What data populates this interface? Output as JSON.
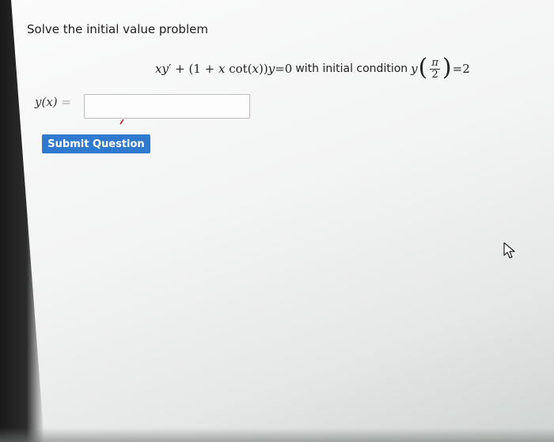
{
  "problem": {
    "instruction": "Solve the initial value problem",
    "equation_lhs_parts": [
      "xy",
      "′ + (1 + ",
      "x",
      " cot(",
      "x",
      "))",
      "y"
    ],
    "equation_eq": "=",
    "equation_rhs": "0",
    "with_text": "with initial condition",
    "ic_func": "y",
    "ic_num": "π",
    "ic_den": "2",
    "ic_eq": "=",
    "ic_value": "2"
  },
  "answer": {
    "label": "y(x)",
    "label_eq": "=",
    "value": "",
    "placeholder": ""
  },
  "submit": {
    "label": "Submit Question"
  },
  "icons": {
    "mouse_pointer": "arrow-pointer-icon",
    "text_cursor": "text-cursor-icon"
  },
  "colors": {
    "button": "#2f79cf",
    "button_text": "#ffffff",
    "text": "#222222"
  }
}
